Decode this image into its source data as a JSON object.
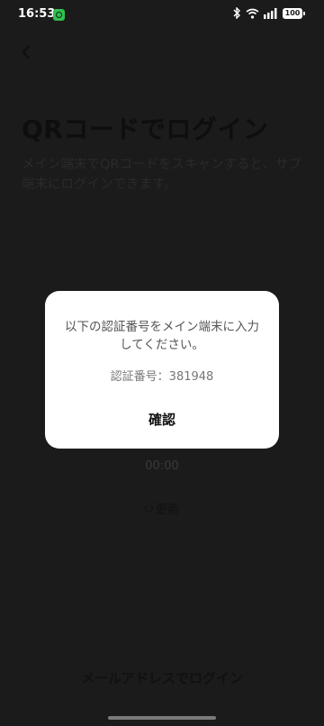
{
  "status_bar": {
    "time": "16:53",
    "battery": "100",
    "icons": [
      "bluetooth-icon",
      "wifi-icon",
      "cellular-5g-icon",
      "battery-icon"
    ]
  },
  "page": {
    "title": "QRコードでログイン",
    "description": "メイン端末でQRコードをスキャンすると、サブ端末にログインできます。",
    "timer": "00:00",
    "refresh_label": "更新",
    "mail_login_label": "メールアドレスでログイン"
  },
  "dialog": {
    "message": "以下の認証番号をメイン端末に入力してください。",
    "code_line": "認証番号：381948",
    "confirm_label": "確認"
  },
  "colors": {
    "background": "#1b1b1b",
    "dialog": "#ffffff",
    "app_badge": "#2fbf4f"
  }
}
